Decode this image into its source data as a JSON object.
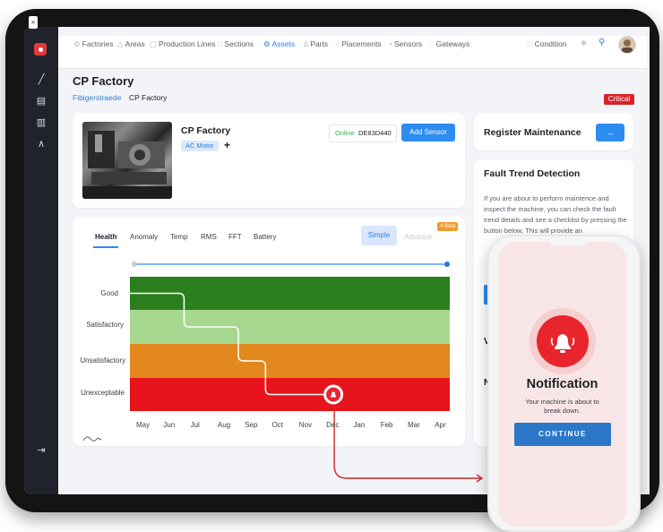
{
  "nav": {
    "items": [
      "Factories",
      "Areas",
      "Production Lines",
      "Sections",
      "Assets",
      "Parts",
      "Placements",
      "Sensors",
      "Gateways"
    ],
    "active_index": 4,
    "condition": "Condition"
  },
  "page": {
    "title": "CP Factory",
    "breadcrumb": [
      "Fibigerstraede",
      "CP Factory"
    ],
    "badge": "Critical"
  },
  "asset": {
    "name": "CP Factory",
    "tag": "AC Motor",
    "add_symbol": "+",
    "status": "Online",
    "sensor_id": "DE83D440",
    "add_sensor_label": "Add Sensor"
  },
  "maintenance": {
    "title": "Register Maintenance",
    "button": "→"
  },
  "fault": {
    "title": "Fault Trend Detection",
    "description": "If you are about to perform maintence and inspect the machine, you can check the fault trend details and see a checklist by pressing the button below. This will provide an"
  },
  "tabs": [
    "Health",
    "Anomaly",
    "Temp",
    "RMS",
    "FFT",
    "Battery"
  ],
  "active_tab": "Health",
  "mode": {
    "simple": "Simple",
    "advance": "Advance",
    "beta": "4 Beta"
  },
  "chart": {
    "levels": [
      "Good",
      "Satisfactory",
      "Unsatisfactory",
      "Unexceptable"
    ],
    "months": [
      "May",
      "Jun",
      "Jul",
      "Aug",
      "Sep",
      "Oct",
      "Nov",
      "Dec",
      "Jan",
      "Feb",
      "Mar",
      "Apr"
    ],
    "trend": [
      {
        "month": "May",
        "level": "Good"
      },
      {
        "month": "Jun",
        "level": "Good"
      },
      {
        "month": "Jul",
        "level": "Satisfactory"
      },
      {
        "month": "Aug",
        "level": "Satisfactory"
      },
      {
        "month": "Sep",
        "level": "Unsatisfactory"
      },
      {
        "month": "Oct",
        "level": "Unexceptable"
      },
      {
        "month": "Nov",
        "level": "Unexceptable"
      },
      {
        "month": "Dec",
        "level": "Unexceptable"
      }
    ],
    "alert_month": "Dec",
    "colors": {
      "Good": "#2a7f1c",
      "Satisfactory": "#a7d88f",
      "Unsatisfactory": "#e3881f",
      "Unexceptable": "#e8141b"
    }
  },
  "notification": {
    "title": "Notification",
    "message": "Your machine is about to break down.",
    "button": "CONTINUE"
  },
  "colors": {
    "accent": "#2d8cf0",
    "critical": "#d9222a",
    "sidebar": "#20232b",
    "arrow": "#d9222a"
  }
}
